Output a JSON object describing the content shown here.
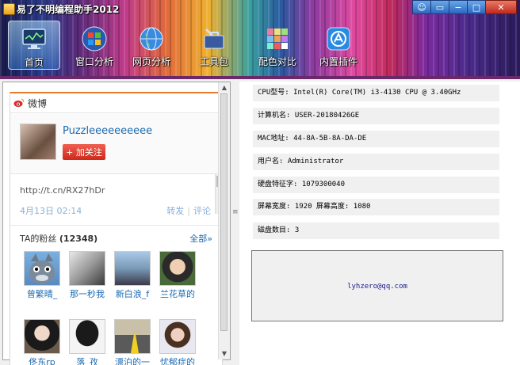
{
  "window": {
    "title": "易了不明编程助手2012",
    "buttons": {
      "feedback_icon": "feedback-icon",
      "skin_icon": "skin-icon",
      "min": "−",
      "max": "□",
      "close": "✕"
    }
  },
  "nav": {
    "items": [
      {
        "label": "首页",
        "icon": "monitor-icon",
        "active": true
      },
      {
        "label": "窗口分析",
        "icon": "windows-logo-icon"
      },
      {
        "label": "网页分析",
        "icon": "globe-icon"
      },
      {
        "label": "工具包",
        "icon": "toolbox-icon"
      },
      {
        "label": "配色对比",
        "icon": "color-palette-icon"
      },
      {
        "label": "内置插件",
        "icon": "plugin-store-icon"
      }
    ]
  },
  "weibo": {
    "title": "微博",
    "username": "Puzzleeeeeeeeee",
    "follow_label": "+ 加关注",
    "post_link": "http://t.cn/RX27hDr",
    "post_date": "4月13日  02:14",
    "repost": "转发",
    "comment": "评论",
    "fans_label": "TA的粉丝",
    "fans_count": "(12348)",
    "fans_all": "全部»",
    "fans": [
      {
        "name": "曾繁晴_"
      },
      {
        "name": "那一秒我"
      },
      {
        "name": "新白浪_f"
      },
      {
        "name": "兰花草的"
      },
      {
        "name": "佟东rp"
      },
      {
        "name": "落_孜"
      },
      {
        "name": "漂泊的一"
      },
      {
        "name": "忧郁症的"
      }
    ]
  },
  "system_info": {
    "rows": [
      "CPU型号: Intel(R) Core(TM) i3-4130 CPU @ 3.40GHz",
      "计算机名: USER-20180426GE",
      "MAC地址: 44-8A-5B-8A-DA-DE",
      "用户名: Administrator",
      "硬盘特征字: 1079300040",
      "屏幕宽度: 1920 屏幕高度: 1080",
      "磁盘数目: 3"
    ],
    "email": "lyhzero@qq.com"
  }
}
